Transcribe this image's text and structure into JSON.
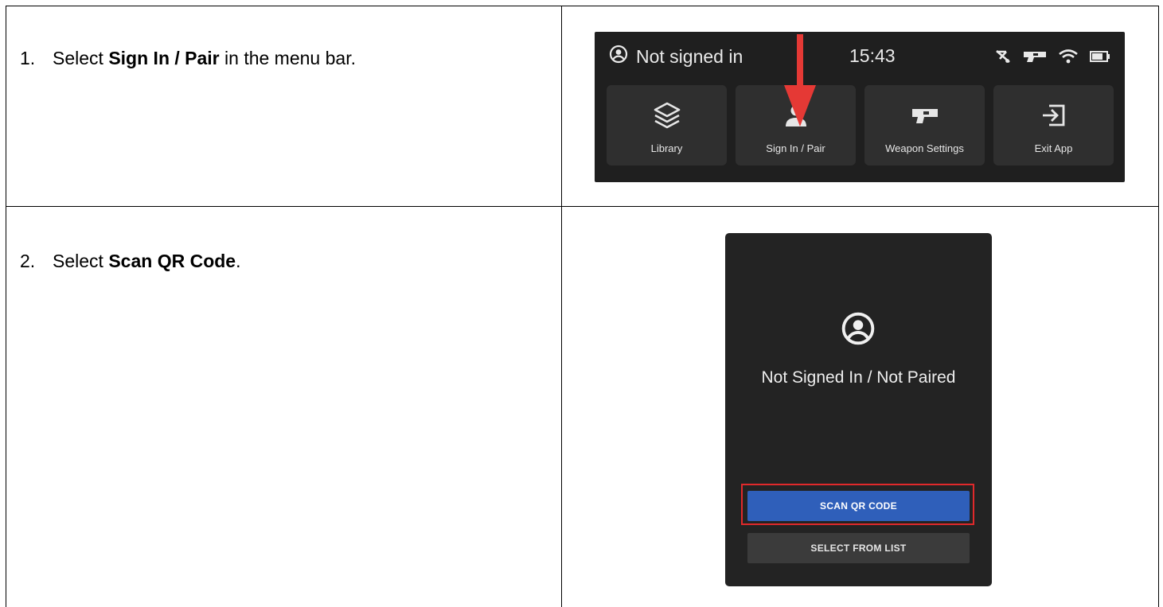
{
  "steps": [
    {
      "number": "1.",
      "before": "Select ",
      "bold": "Sign In / Pair",
      "after": " in the menu bar."
    },
    {
      "number": "2.",
      "before": "Select ",
      "bold": "Scan QR Code",
      "after": "."
    }
  ],
  "menubar": {
    "status_text": "Not signed in",
    "time": "15:43",
    "status_icons": [
      "network-off-icon",
      "weapon-icon",
      "wifi-icon",
      "battery-icon"
    ],
    "tiles": [
      {
        "label": "Library",
        "icon": "layers-icon"
      },
      {
        "label": "Sign In / Pair",
        "icon": "person-icon"
      },
      {
        "label": "Weapon Settings",
        "icon": "weapon-icon"
      },
      {
        "label": "Exit App",
        "icon": "exit-icon"
      }
    ]
  },
  "dialog": {
    "title": "Not Signed In / Not Paired",
    "icon": "account-circle-icon",
    "scan_button": "SCAN QR CODE",
    "list_button": "SELECT FROM LIST"
  },
  "colors": {
    "highlight": "#e0292b",
    "arrow": "#e53935",
    "primary_button": "#2f5fba",
    "panel": "#232323"
  }
}
